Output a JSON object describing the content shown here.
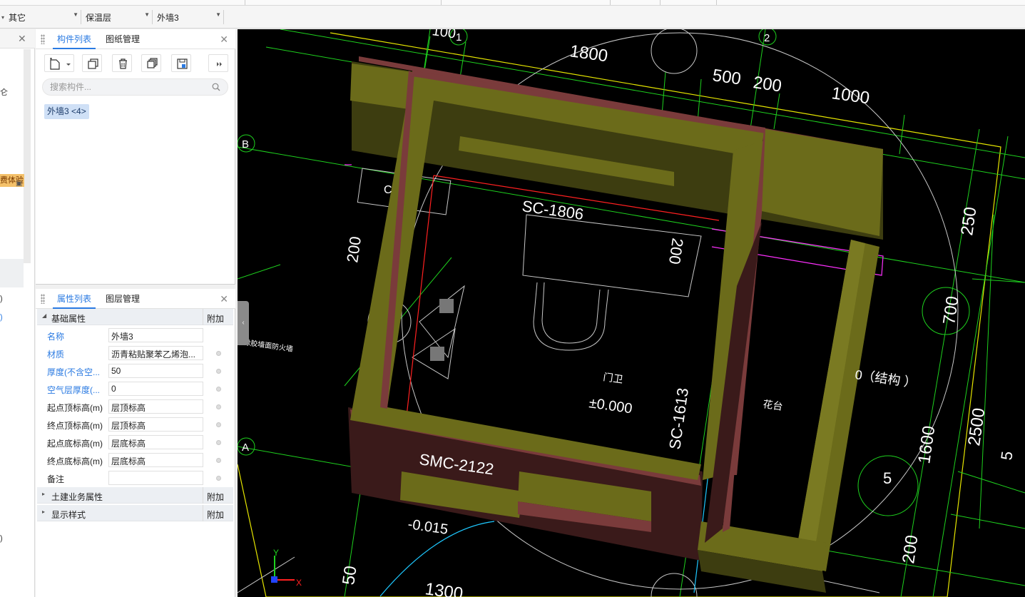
{
  "filters": [
    {
      "value": "其它"
    },
    {
      "value": "保温层"
    },
    {
      "value": "外墙3"
    }
  ],
  "left_panel": {
    "badge": "费体验",
    "fragments": [
      "仑",
      ")",
      ")",
      ")"
    ]
  },
  "component_panel": {
    "tabs": [
      "构件列表",
      "图纸管理"
    ],
    "search_placeholder": "搜索构件...",
    "item": "外墙3 <4>"
  },
  "property_panel": {
    "tabs": [
      "属性列表",
      "图层管理"
    ],
    "group_basic": "基础属性",
    "add_label": "附加",
    "properties": [
      {
        "name": "名称",
        "value": "外墙3",
        "blue": true
      },
      {
        "name": "材质",
        "value": "沥青粘贴聚苯乙烯泡...",
        "blue": true
      },
      {
        "name": "厚度(不含空...",
        "value": "50",
        "blue": true
      },
      {
        "name": "空气层厚度(...",
        "value": "0",
        "blue": true
      },
      {
        "name": "起点顶标高(m)",
        "value": "层顶标高",
        "blue": false
      },
      {
        "name": "终点顶标高(m)",
        "value": "层顶标高",
        "blue": false
      },
      {
        "name": "起点底标高(m)",
        "value": "层底标高",
        "blue": false
      },
      {
        "name": "终点底标高(m)",
        "value": "层底标高",
        "blue": false
      },
      {
        "name": "备注",
        "value": "",
        "blue": false
      }
    ],
    "group_civil": "土建业务属性",
    "group_display": "显示样式"
  },
  "viewport": {
    "dims": [
      "100",
      "1",
      "2",
      "1800",
      "500",
      "200",
      "1000",
      "250",
      "700",
      "2500",
      "1600",
      "200",
      "1300",
      "50",
      "200",
      "200",
      "5",
      "C",
      "5"
    ],
    "labels": [
      "SC-1806",
      "SC-1613",
      "SMC-2122",
      "-0.015",
      "±0.000",
      "门卫",
      "花台",
      "0（结构 ）",
      "橡胶墙面防火墙"
    ],
    "axis_labels": [
      "B",
      "A"
    ],
    "axis_x": "X",
    "axis_y": "Y"
  },
  "colors": {
    "wall_top": "#6b6b1a",
    "wall_side": "#3d3d10",
    "wall_maroon": "#7a3b3b",
    "wall_dark": "#3a1a1a",
    "cad_green": "#1ed11e",
    "cad_yellow": "#e6e600",
    "accent": "#2a7ae2"
  }
}
